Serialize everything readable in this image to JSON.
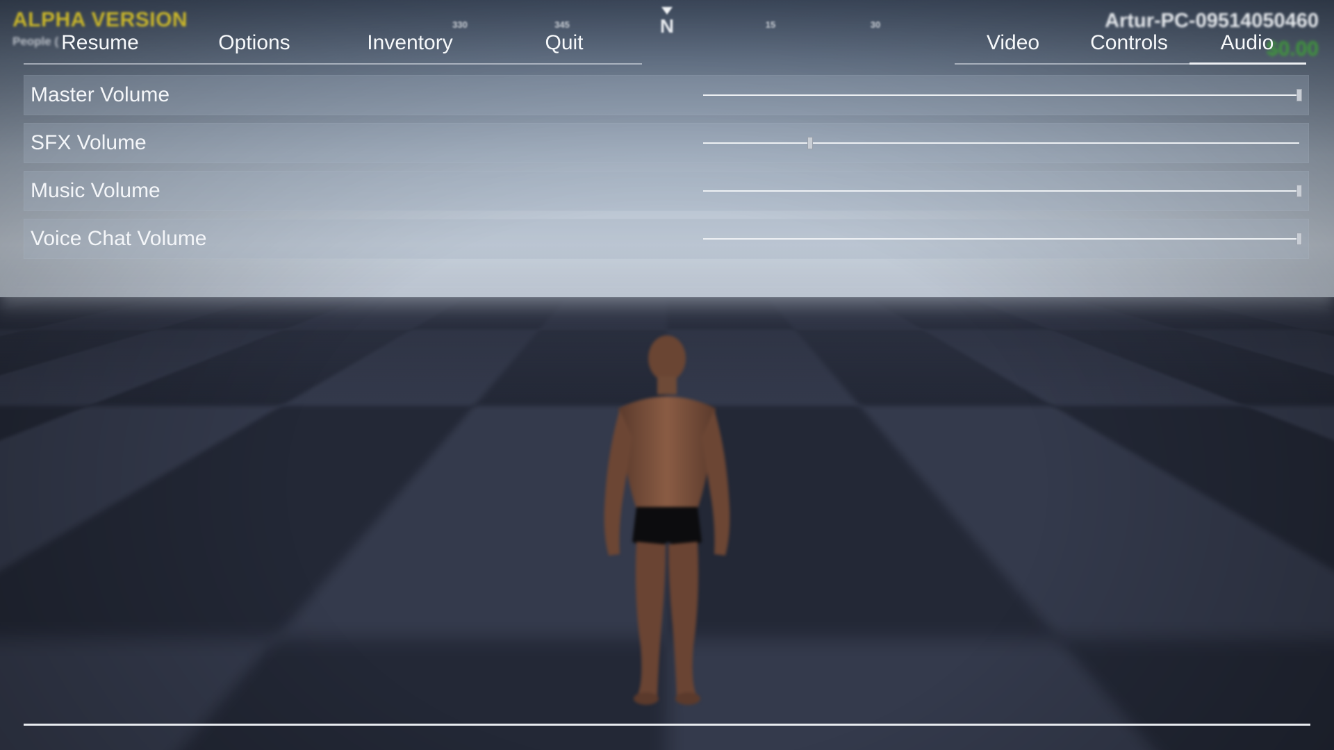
{
  "hud": {
    "version_text": "ALPHA VERSION",
    "people_text": "People (",
    "player_name": "Artur-PC-09514050460",
    "money": "$0.00",
    "compass": {
      "north_label": "N",
      "ticks": [
        "330",
        "345",
        "15",
        "30"
      ]
    }
  },
  "menu": {
    "main_tabs": [
      {
        "label": "Resume"
      },
      {
        "label": "Options"
      },
      {
        "label": "Inventory"
      },
      {
        "label": "Quit"
      }
    ],
    "settings_tabs": [
      {
        "label": "Video"
      },
      {
        "label": "Controls"
      },
      {
        "label": "Audio",
        "active": true
      }
    ],
    "active_settings_tab": "Audio"
  },
  "audio_settings": [
    {
      "label": "Master Volume",
      "value": 1.0
    },
    {
      "label": "SFX Volume",
      "value": 0.18
    },
    {
      "label": "Music Volume",
      "value": 1.0
    },
    {
      "label": "Voice Chat Volume",
      "value": 1.0
    }
  ],
  "colors": {
    "version_text": "#c8b52a",
    "money": "#3f9a3a",
    "menu_text": "#f6f8fa"
  }
}
